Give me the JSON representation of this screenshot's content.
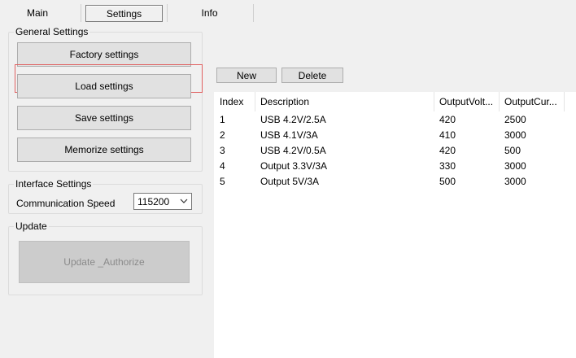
{
  "tabs": [
    {
      "label": "Main",
      "active": false
    },
    {
      "label": "Settings",
      "active": true
    },
    {
      "label": "Info",
      "active": false
    }
  ],
  "general": {
    "title": "General Settings",
    "factory": "Factory settings",
    "load": "Load settings",
    "save": "Save settings",
    "memorize": "Memorize settings"
  },
  "interface": {
    "title": "Interface Settings",
    "speed_label": "Communication Speed",
    "speed_value": "115200"
  },
  "update": {
    "title": "Update",
    "button": "Update _Authorize"
  },
  "toolbar": {
    "new": "New",
    "delete": "Delete"
  },
  "table": {
    "columns": [
      "Index",
      "Description",
      "OutputVolt...",
      "OutputCur..."
    ],
    "rows": [
      [
        "1",
        "USB 4.2V/2.5A",
        "420",
        "2500"
      ],
      [
        "2",
        "USB 4.1V/3A",
        "410",
        "3000"
      ],
      [
        "3",
        "USB 4.2V/0.5A",
        "420",
        "500"
      ],
      [
        "4",
        "Output 3.3V/3A",
        "330",
        "3000"
      ],
      [
        "5",
        "Output 5V/3A",
        "500",
        "3000"
      ]
    ]
  },
  "colors": {
    "background": "#f0f0f0",
    "focus_ring": "#e06060",
    "button_face": "#e1e1e1",
    "disabled_button": "#cccccc",
    "table_background": "#ffffff"
  },
  "icons": {
    "combo_arrow": "chevron-down-icon"
  }
}
